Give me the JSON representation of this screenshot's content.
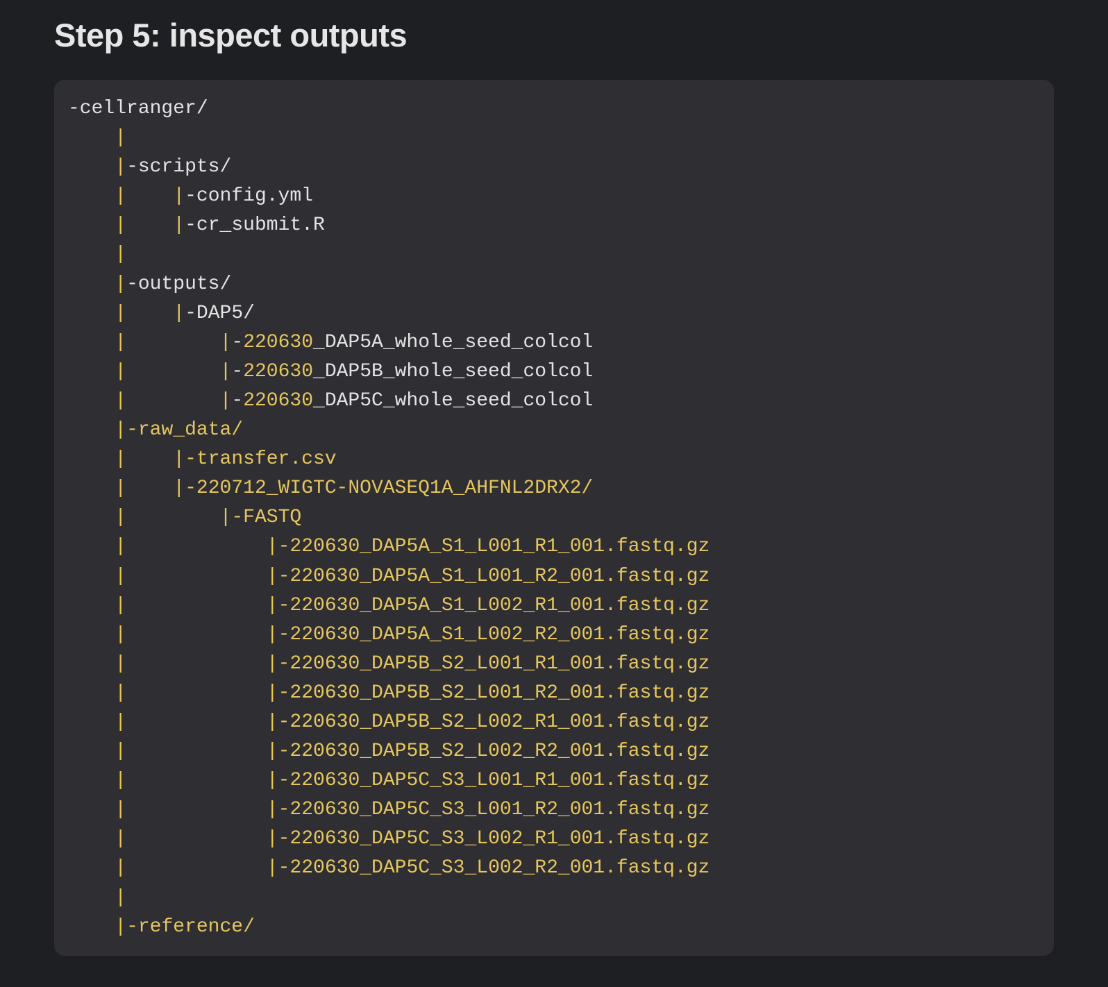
{
  "heading": "Step 5: inspect outputs",
  "colors": {
    "background": "#1e1f22",
    "code_background": "#2e2e33",
    "text_default": "#e4e4e4",
    "text_highlight": "#e6c65e"
  },
  "tree": [
    {
      "prefix": "",
      "text": "-cellranger/",
      "highlight": false
    },
    {
      "prefix": "    |",
      "text": "",
      "highlight": false
    },
    {
      "prefix": "    |",
      "text": "-scripts/",
      "highlight": false
    },
    {
      "prefix": "    |    |",
      "text": "-config.yml",
      "highlight": false
    },
    {
      "prefix": "    |    |",
      "text": "-cr_submit.R",
      "highlight": false
    },
    {
      "prefix": "    |",
      "text": "",
      "highlight": false
    },
    {
      "prefix": "    |",
      "text": "-outputs/",
      "highlight": false
    },
    {
      "prefix": "    |    |",
      "text": "-DAP5/",
      "highlight": false
    },
    {
      "prefix": "    |        |",
      "text": "-220630_DAP5A_whole_seed_colcol",
      "highlight_prefix": "-220630",
      "rest": "_DAP5A_whole_seed_colcol",
      "highlight": "partial"
    },
    {
      "prefix": "    |        |",
      "text": "-220630_DAP5B_whole_seed_colcol",
      "highlight_prefix": "-220630",
      "rest": "_DAP5B_whole_seed_colcol",
      "highlight": "partial"
    },
    {
      "prefix": "    |        |",
      "text": "-220630_DAP5C_whole_seed_colcol",
      "highlight_prefix": "-220630",
      "rest": "_DAP5C_whole_seed_colcol",
      "highlight": "partial"
    },
    {
      "prefix": "    |",
      "text": "-raw_data/",
      "highlight": true
    },
    {
      "prefix": "    |    |",
      "text": "-transfer.csv",
      "highlight": true
    },
    {
      "prefix": "    |    |",
      "text": "-220712_WIGTC-NOVASEQ1A_AHFNL2DRX2/",
      "highlight": true
    },
    {
      "prefix": "    |        |",
      "text": "-FASTQ",
      "highlight": true
    },
    {
      "prefix": "    |            |",
      "text": "-220630_DAP5A_S1_L001_R1_001.fastq.gz",
      "highlight": true
    },
    {
      "prefix": "    |            |",
      "text": "-220630_DAP5A_S1_L001_R2_001.fastq.gz",
      "highlight": true
    },
    {
      "prefix": "    |            |",
      "text": "-220630_DAP5A_S1_L002_R1_001.fastq.gz",
      "highlight": true
    },
    {
      "prefix": "    |            |",
      "text": "-220630_DAP5A_S1_L002_R2_001.fastq.gz",
      "highlight": true
    },
    {
      "prefix": "    |            |",
      "text": "-220630_DAP5B_S2_L001_R1_001.fastq.gz",
      "highlight": true
    },
    {
      "prefix": "    |            |",
      "text": "-220630_DAP5B_S2_L001_R2_001.fastq.gz",
      "highlight": true
    },
    {
      "prefix": "    |            |",
      "text": "-220630_DAP5B_S2_L002_R1_001.fastq.gz",
      "highlight": true
    },
    {
      "prefix": "    |            |",
      "text": "-220630_DAP5B_S2_L002_R2_001.fastq.gz",
      "highlight": true
    },
    {
      "prefix": "    |            |",
      "text": "-220630_DAP5C_S3_L001_R1_001.fastq.gz",
      "highlight": true
    },
    {
      "prefix": "    |            |",
      "text": "-220630_DAP5C_S3_L001_R2_001.fastq.gz",
      "highlight": true
    },
    {
      "prefix": "    |            |",
      "text": "-220630_DAP5C_S3_L002_R1_001.fastq.gz",
      "highlight": true
    },
    {
      "prefix": "    |            |",
      "text": "-220630_DAP5C_S3_L002_R2_001.fastq.gz",
      "highlight": true
    },
    {
      "prefix": "    |",
      "text": "",
      "highlight": true
    },
    {
      "prefix": "    |",
      "text": "-reference/",
      "highlight": true
    }
  ]
}
